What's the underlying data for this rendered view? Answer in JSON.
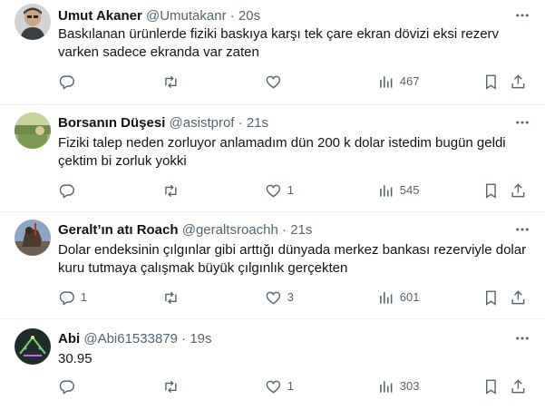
{
  "tweets": [
    {
      "name": "Umut Akaner",
      "handle": "@Umutakanr",
      "sep": "·",
      "time": "20s",
      "text": "Baskılanan ürünlerde fiziki baskıya karşı tek çare ekran dövizi eksi rezerv varken sadece ekranda var zaten",
      "replies": "",
      "retweets": "",
      "likes": "",
      "views": "467"
    },
    {
      "name": "Borsanın Düşesi",
      "handle": "@asistprof",
      "sep": "·",
      "time": "21s",
      "text": "Fiziki talep neden zorluyor anlamadım dün 200 k dolar istedim bugün geldi çektim bi zorluk yokki",
      "replies": "",
      "retweets": "",
      "likes": "1",
      "views": "545"
    },
    {
      "name": "Geralt’ın atı Roach",
      "handle": "@geraltsroachh",
      "sep": "·",
      "time": "21s",
      "text": "Dolar endeksinin çılgınlar gibi arttığı dünyada merkez bankası rezerviyle dolar kuru tutmaya çalışmak büyük çılgınlık gerçekten",
      "replies": "1",
      "retweets": "",
      "likes": "3",
      "views": "601"
    },
    {
      "name": "Abi",
      "handle": "@Abi61533879",
      "sep": "·",
      "time": "19s",
      "text": "30.95",
      "replies": "",
      "retweets": "",
      "likes": "1",
      "views": "303"
    }
  ],
  "icons": {
    "reply": "reply-icon",
    "retweet": "retweet-icon",
    "like": "heart-icon",
    "views": "views-icon",
    "bookmark": "bookmark-icon",
    "share": "share-icon",
    "more": "more-icon"
  },
  "colors": {
    "text": "#0f1419",
    "secondary": "#536471",
    "divider": "#eff3f4"
  }
}
